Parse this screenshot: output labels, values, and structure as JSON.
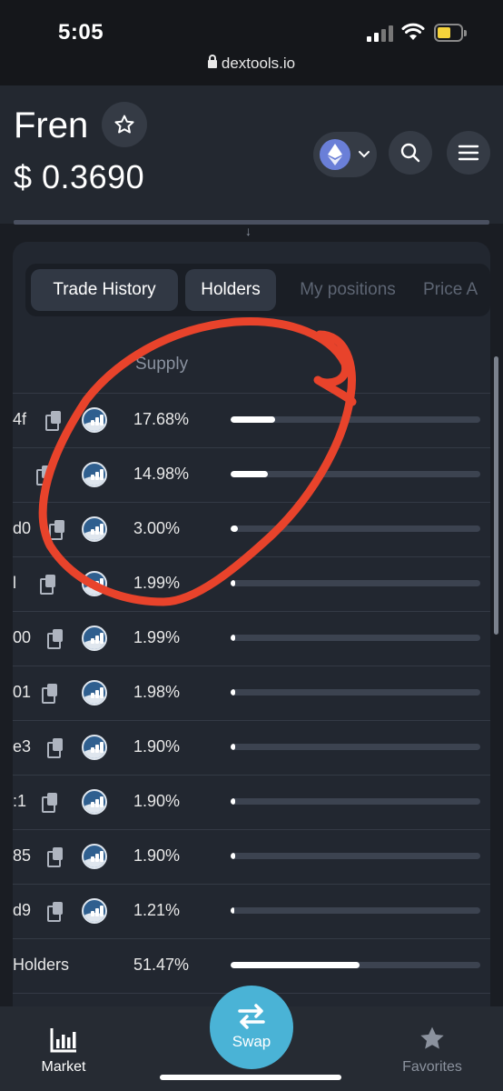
{
  "status": {
    "time": "5:05",
    "url": "dextools.io"
  },
  "header": {
    "title": "Fren",
    "price": "$ 0.3690"
  },
  "tabs": [
    {
      "label": "Trade History",
      "active": true
    },
    {
      "label": "Holders",
      "active": true
    },
    {
      "label": "My positions",
      "active": false
    },
    {
      "label": "Price A",
      "active": false
    }
  ],
  "table": {
    "supply_header": "Supply",
    "rows": [
      {
        "addr": "4f",
        "pct": "17.68%",
        "share": 0.1768
      },
      {
        "addr": "",
        "pct": "14.98%",
        "share": 0.1498
      },
      {
        "addr": "d0",
        "pct": "3.00%",
        "share": 0.03
      },
      {
        "addr": "l",
        "pct": "1.99%",
        "share": 0.0199
      },
      {
        "addr": "00",
        "pct": "1.99%",
        "share": 0.0199
      },
      {
        "addr": "01",
        "pct": "1.98%",
        "share": 0.0198
      },
      {
        "addr": "e3",
        "pct": "1.90%",
        "share": 0.019
      },
      {
        "addr": ":1",
        "pct": "1.90%",
        "share": 0.019
      },
      {
        "addr": "85",
        "pct": "1.90%",
        "share": 0.019
      },
      {
        "addr": "d9",
        "pct": "1.21%",
        "share": 0.0121
      }
    ],
    "total": {
      "label": "Holders",
      "pct": "51.47%",
      "share": 0.5147
    }
  },
  "nav": {
    "market": "Market",
    "swap": "Swap",
    "favorites": "Favorites"
  },
  "colors": {
    "annotation": "#e8432b",
    "swap": "#4ab3d6",
    "eth": "#6a7fd8"
  }
}
